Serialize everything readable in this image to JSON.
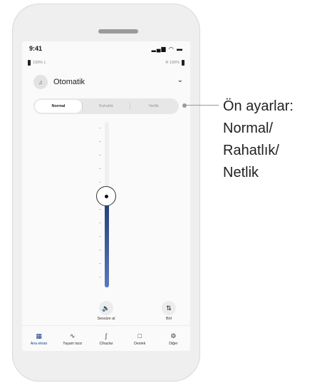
{
  "status": {
    "time": "9:41",
    "icons": "▂▄▆ ◠ ▬"
  },
  "battery": {
    "left_label": "100% L",
    "right_label": "R 100%"
  },
  "program": {
    "icon": "program-icon",
    "name": "Otomatik"
  },
  "presets": [
    {
      "label": "Normal",
      "active": true
    },
    {
      "label": "Rahatlık",
      "active": false
    },
    {
      "label": "Netlik",
      "active": false
    }
  ],
  "volume": {
    "level": 0.55
  },
  "controls": {
    "mute_label": "Sessize al",
    "split_label": "Böl"
  },
  "tabbar": [
    {
      "label": "Ana ekran",
      "icon": "grid-icon",
      "active": true
    },
    {
      "label": "Yaşam tarzı",
      "icon": "activity-icon",
      "active": false
    },
    {
      "label": "Cihazlar",
      "icon": "hearing-aid-icon",
      "active": false
    },
    {
      "label": "Destek",
      "icon": "chat-icon",
      "active": false
    },
    {
      "label": "Diğer",
      "icon": "gear-icon",
      "active": false
    }
  ],
  "callout": {
    "line1": "Ön ayarlar:",
    "line2": "Normal/",
    "line3": "Rahatlık/",
    "line4": "Netlik"
  }
}
